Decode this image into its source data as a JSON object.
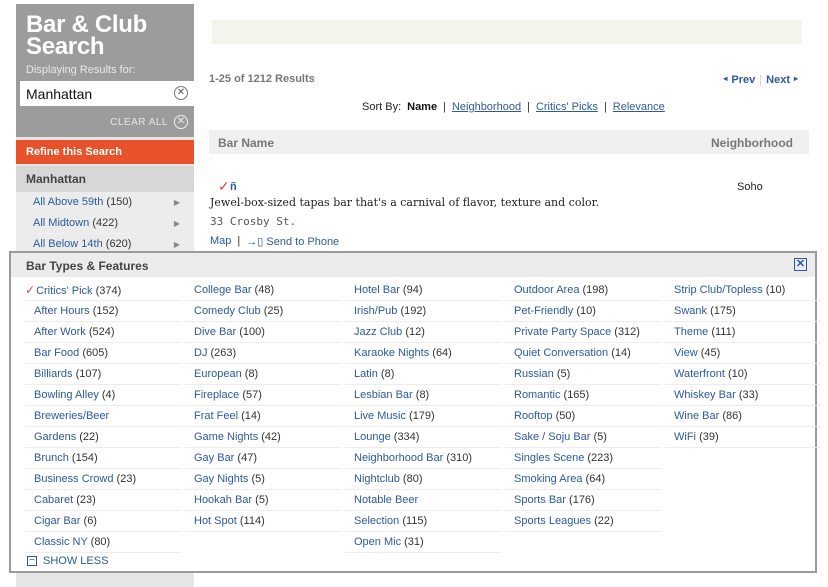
{
  "sidebar": {
    "title_line1": "Bar & Club",
    "title_line2": "Search",
    "subtitle": "Displaying Results for:",
    "location_value": "Manhattan",
    "clear_all": "CLEAR ALL",
    "refine": "Refine this Search",
    "location_header": "Manhattan",
    "items": [
      {
        "label": "All Above 59th",
        "count": "(150)"
      },
      {
        "label": "All Midtown",
        "count": "(422)"
      },
      {
        "label": "All Below 14th",
        "count": "(620)"
      }
    ]
  },
  "results": {
    "summary": "1-25 of 1212 Results",
    "prev": "Prev",
    "next": "Next"
  },
  "sort": {
    "label": "Sort By:",
    "options": [
      "Name",
      "Neighborhood",
      "Critics' Picks",
      "Relevance"
    ]
  },
  "columns": {
    "name": "Bar Name",
    "neighborhood": "Neighborhood"
  },
  "entry": {
    "name": "ñ",
    "neighborhood": "Soho",
    "description": "Jewel-box-sized tapas bar that's a carnival of flavor, texture and color.",
    "address": "33 Crosby St.",
    "map": "Map",
    "send": "Send to Phone"
  },
  "overlay": {
    "title": "Bar Types & Features",
    "show_less": "SHOW LESS",
    "columns": [
      [
        {
          "label": "Critics' Pick",
          "count": "(374)",
          "checked": true
        },
        {
          "label": "After Hours",
          "count": "(152)"
        },
        {
          "label": "After Work",
          "count": "(524)"
        },
        {
          "label": "Bar Food",
          "count": "(605)"
        },
        {
          "label": "Billiards",
          "count": "(107)"
        },
        {
          "label": "Bowling Alley",
          "count": "(4)"
        },
        {
          "label": "Breweries/Beer",
          "count": ""
        },
        {
          "label": "Gardens",
          "count": "(22)"
        },
        {
          "label": "Brunch",
          "count": "(154)"
        },
        {
          "label": "Business Crowd",
          "count": "(23)"
        },
        {
          "label": "Cabaret",
          "count": "(23)"
        },
        {
          "label": "Cigar Bar",
          "count": "(6)"
        },
        {
          "label": "Classic NY",
          "count": "(80)"
        }
      ],
      [
        {
          "label": "College Bar",
          "count": "(48)"
        },
        {
          "label": "Comedy Club",
          "count": "(25)"
        },
        {
          "label": "Dive Bar",
          "count": "(100)"
        },
        {
          "label": "DJ",
          "count": "(263)"
        },
        {
          "label": "European",
          "count": "(8)"
        },
        {
          "label": "Fireplace",
          "count": "(57)"
        },
        {
          "label": "Frat Feel",
          "count": "(14)"
        },
        {
          "label": "Game Nights",
          "count": "(42)"
        },
        {
          "label": "Gay Bar",
          "count": "(47)"
        },
        {
          "label": "Gay Nights",
          "count": "(5)"
        },
        {
          "label": "Hookah Bar",
          "count": "(5)"
        },
        {
          "label": "Hot Spot",
          "count": "(114)"
        }
      ],
      [
        {
          "label": "Hotel Bar",
          "count": "(94)"
        },
        {
          "label": "Irish/Pub",
          "count": "(192)"
        },
        {
          "label": "Jazz Club",
          "count": "(12)"
        },
        {
          "label": "Karaoke Nights",
          "count": "(64)"
        },
        {
          "label": "Latin",
          "count": "(8)"
        },
        {
          "label": "Lesbian Bar",
          "count": "(8)"
        },
        {
          "label": "Live Music",
          "count": "(179)"
        },
        {
          "label": "Lounge",
          "count": "(334)"
        },
        {
          "label": "Neighborhood Bar",
          "count": "(310)"
        },
        {
          "label": "Nightclub",
          "count": "(80)"
        },
        {
          "label": "Notable Beer",
          "count": ""
        },
        {
          "label": "Selection",
          "count": "(115)"
        },
        {
          "label": "Open Mic",
          "count": "(31)"
        }
      ],
      [
        {
          "label": "Outdoor Area",
          "count": "(198)"
        },
        {
          "label": "Pet-Friendly",
          "count": "(10)"
        },
        {
          "label": "Private Party Space",
          "count": "(312)"
        },
        {
          "label": "Quiet Conversation",
          "count": "(14)"
        },
        {
          "label": "Russian",
          "count": "(5)"
        },
        {
          "label": "Romantic",
          "count": "(165)"
        },
        {
          "label": "Rooftop",
          "count": "(50)"
        },
        {
          "label": "Sake / Soju Bar",
          "count": "(5)"
        },
        {
          "label": "Singles Scene",
          "count": "(223)"
        },
        {
          "label": "Smoking Area",
          "count": "(64)"
        },
        {
          "label": "Sports Bar",
          "count": "(176)"
        },
        {
          "label": "Sports Leagues",
          "count": "(22)"
        }
      ],
      [
        {
          "label": "Strip Club/Topless",
          "count": "(10)"
        },
        {
          "label": "Swank",
          "count": "(175)"
        },
        {
          "label": "Theme",
          "count": "(111)"
        },
        {
          "label": "View",
          "count": "(45)"
        },
        {
          "label": "Waterfront",
          "count": "(10)"
        },
        {
          "label": "Whiskey Bar",
          "count": "(33)"
        },
        {
          "label": "Wine Bar",
          "count": "(86)"
        },
        {
          "label": "WiFi",
          "count": "(39)"
        }
      ]
    ]
  }
}
